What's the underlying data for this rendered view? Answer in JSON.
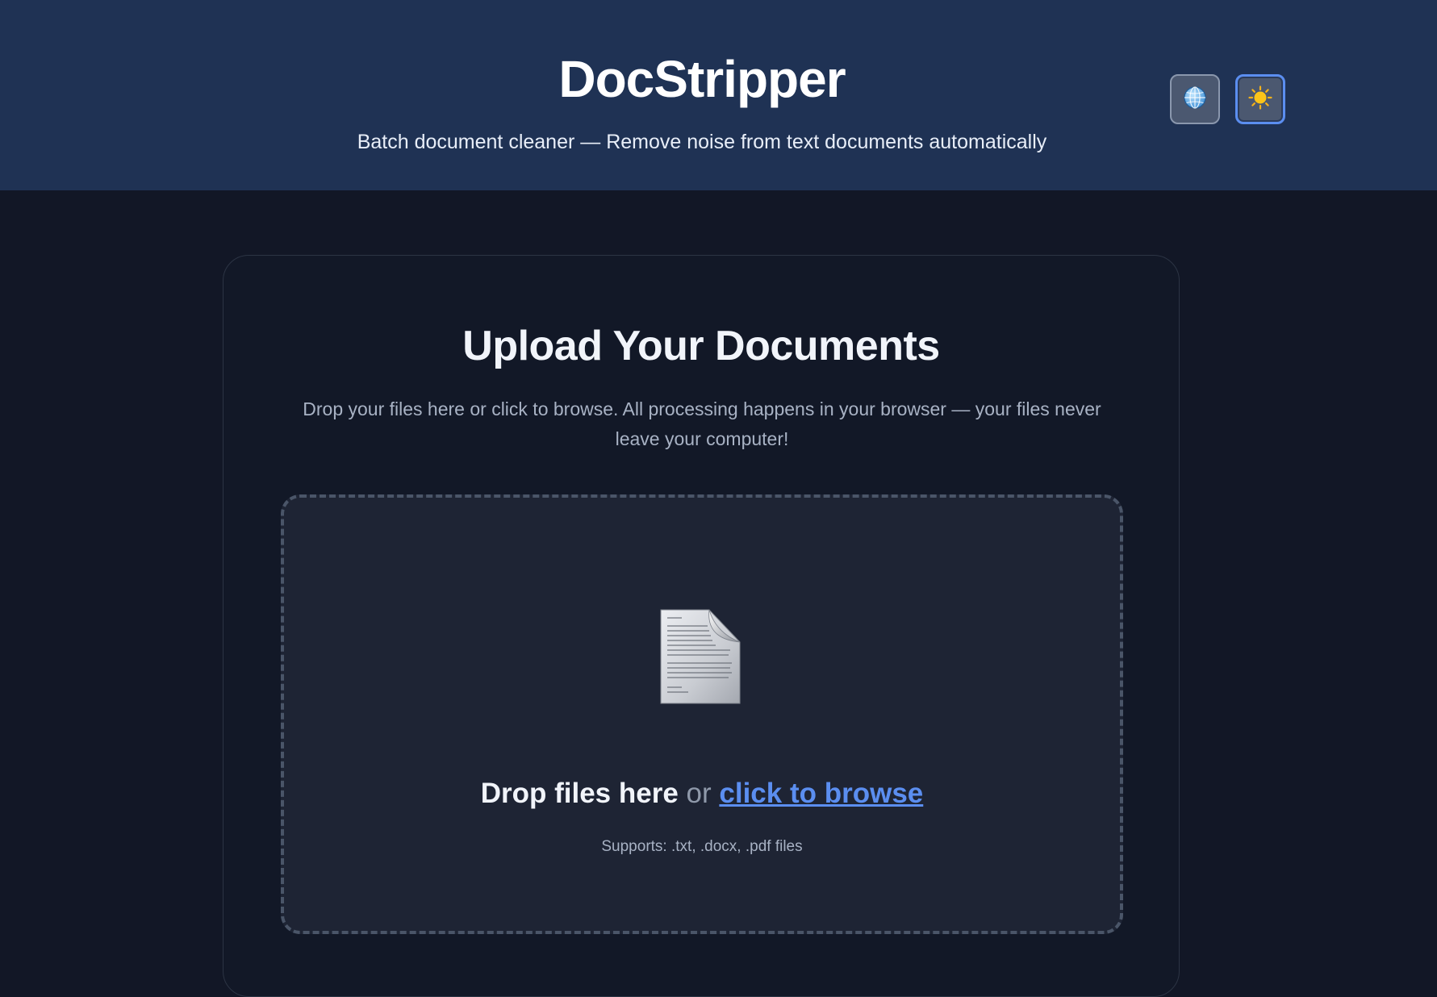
{
  "header": {
    "title": "DocStripper",
    "subtitle": "Batch document cleaner — Remove noise from text documents automatically",
    "language_button_icon": "globe-icon",
    "theme_button_icon": "sun-icon"
  },
  "upload": {
    "title": "Upload Your Documents",
    "description": "Drop your files here or click to browse. All processing happens in your browser — your files never leave your computer!",
    "dropzone": {
      "icon": "document-icon",
      "drop_text": "Drop files here",
      "or_text": "or",
      "browse_text": "click to browse",
      "supports_text": "Supports: .txt, .docx, .pdf files"
    }
  },
  "colors": {
    "header_bg": "#1f3254",
    "page_bg": "#121726",
    "accent": "#5b8ef0",
    "dropzone_bg": "#1e2434"
  }
}
